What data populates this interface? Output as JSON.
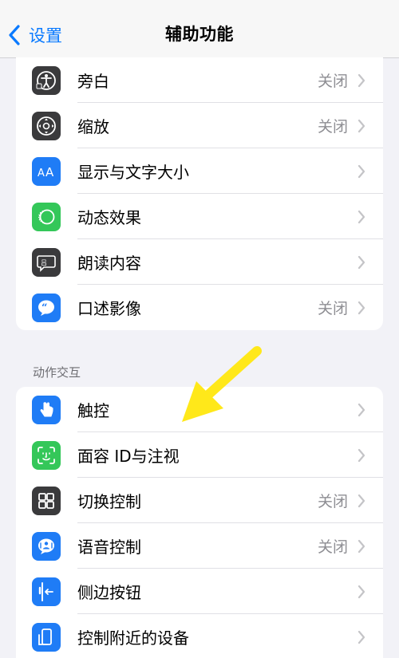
{
  "navbar": {
    "back_label": "设置",
    "title": "辅助功能"
  },
  "section1": {
    "rows": [
      {
        "label": "旁白",
        "value": "关闭",
        "icon": "voiceover-icon",
        "color": "#3a3a3c"
      },
      {
        "label": "缩放",
        "value": "关闭",
        "icon": "zoom-icon",
        "color": "#3a3a3c"
      },
      {
        "label": "显示与文字大小",
        "value": "",
        "icon": "text-size-icon",
        "color": "#1f7cf6"
      },
      {
        "label": "动态效果",
        "value": "",
        "icon": "motion-icon",
        "color": "#34c759"
      },
      {
        "label": "朗读内容",
        "value": "",
        "icon": "spoken-content-icon",
        "color": "#3a3a3c"
      },
      {
        "label": "口述影像",
        "value": "关闭",
        "icon": "audio-description-icon",
        "color": "#1f7cf6"
      }
    ]
  },
  "section2": {
    "header": "动作交互",
    "rows": [
      {
        "label": "触控",
        "value": "",
        "icon": "touch-icon",
        "color": "#1f7cf6"
      },
      {
        "label": "面容 ID与注视",
        "value": "",
        "icon": "face-id-icon",
        "color": "#34c759"
      },
      {
        "label": "切换控制",
        "value": "关闭",
        "icon": "switch-control-icon",
        "color": "#3a3a3c"
      },
      {
        "label": "语音控制",
        "value": "关闭",
        "icon": "voice-control-icon",
        "color": "#1f7cf6"
      },
      {
        "label": "侧边按钮",
        "value": "",
        "icon": "side-button-icon",
        "color": "#1f7cf6"
      },
      {
        "label": "控制附近的设备",
        "value": "",
        "icon": "nearby-devices-icon",
        "color": "#1f7cf6"
      }
    ]
  },
  "annotation": {
    "arrow_color": "#ffe81a"
  }
}
